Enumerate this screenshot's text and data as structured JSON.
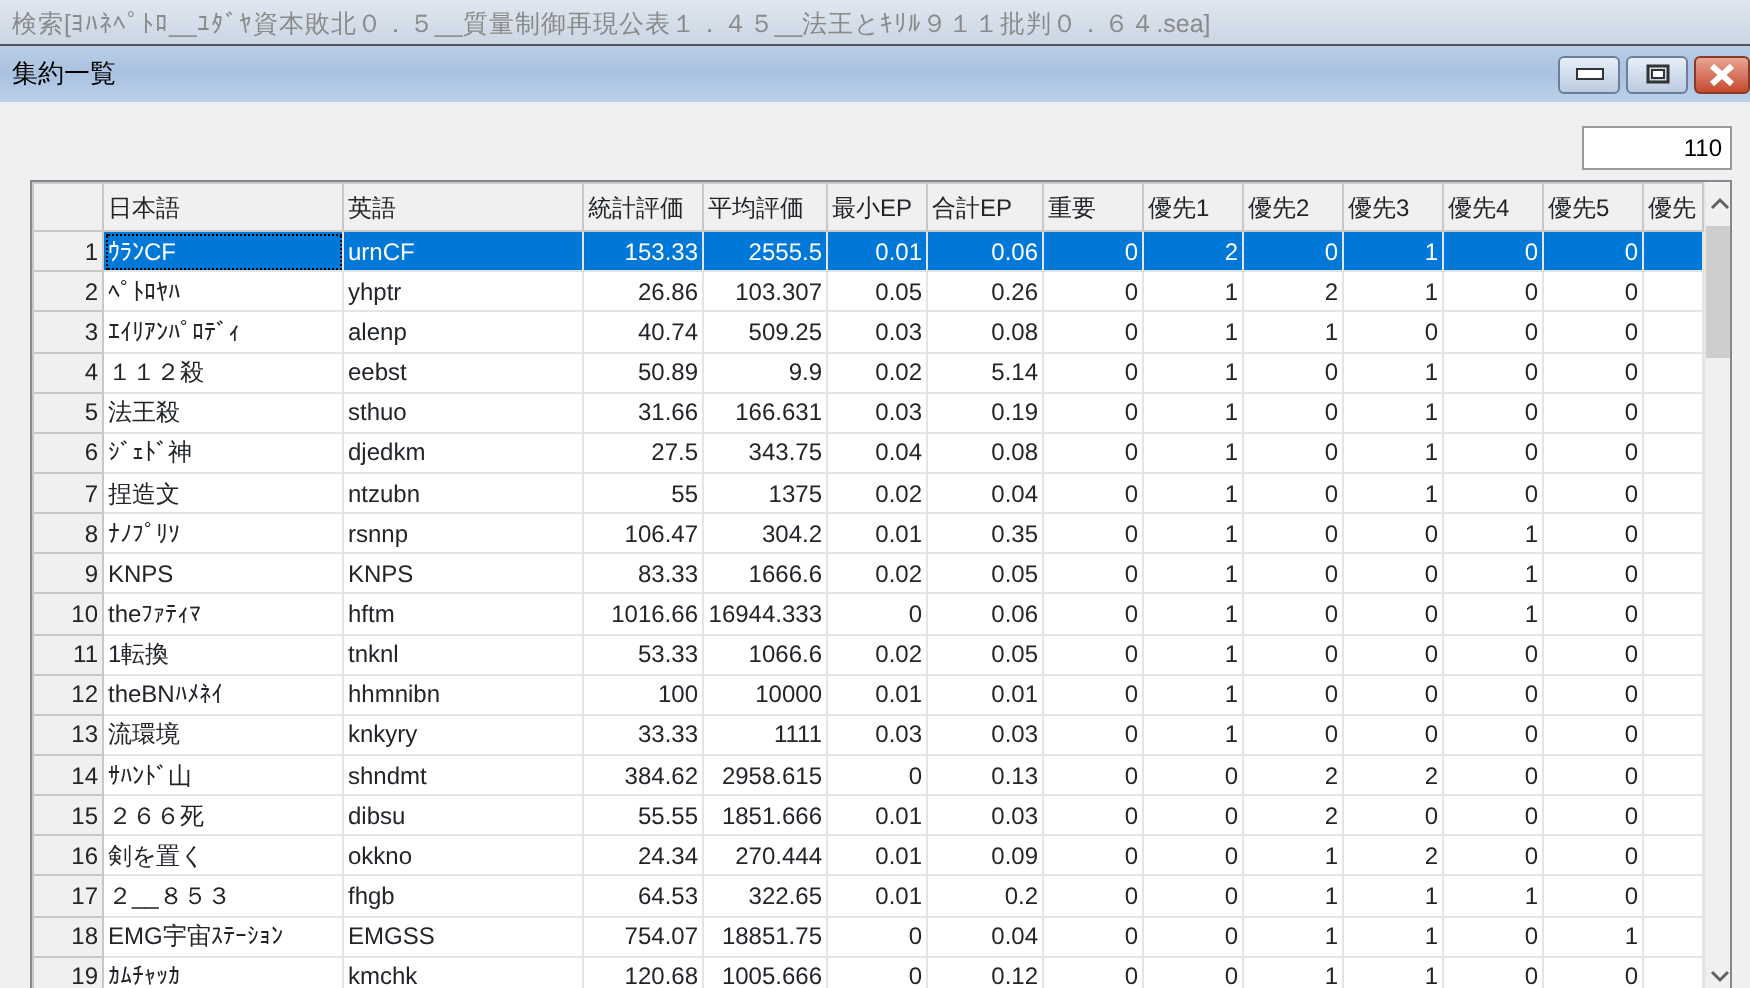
{
  "app_title": "検索[ﾖﾊﾈﾍﾟﾄﾛ__ﾕﾀﾞﾔ資本敗北０．５__質量制御再現公表１．４５__法王とｷﾘﾙ９１１批判０．６４.sea]",
  "window": {
    "title": "集約一覧"
  },
  "count_field": {
    "value": "110"
  },
  "table": {
    "columns": [
      "日本語",
      "英語",
      "統計評価",
      "平均評価",
      "最小EP",
      "合計EP",
      "重要",
      "優先1",
      "優先2",
      "優先3",
      "優先4",
      "優先5",
      "優先"
    ],
    "rows": [
      {
        "index": "1",
        "selected": true,
        "cells": [
          "ｳﾗﾝCF",
          "urnCF",
          "153.33",
          "2555.5",
          "0.01",
          "0.06",
          "0",
          "2",
          "0",
          "1",
          "0",
          "0"
        ]
      },
      {
        "index": "2",
        "selected": false,
        "cells": [
          "ﾍﾟﾄﾛﾔﾊ",
          "yhptr",
          "26.86",
          "103.307",
          "0.05",
          "0.26",
          "0",
          "1",
          "2",
          "1",
          "0",
          "0"
        ]
      },
      {
        "index": "3",
        "selected": false,
        "cells": [
          "ｴｲﾘｱﾝﾊﾟﾛﾃﾞｨ",
          "alenp",
          "40.74",
          "509.25",
          "0.03",
          "0.08",
          "0",
          "1",
          "1",
          "0",
          "0",
          "0"
        ]
      },
      {
        "index": "4",
        "selected": false,
        "cells": [
          "１１２殺",
          "eebst",
          "50.89",
          "9.9",
          "0.02",
          "5.14",
          "0",
          "1",
          "0",
          "1",
          "0",
          "0"
        ]
      },
      {
        "index": "5",
        "selected": false,
        "cells": [
          "法王殺",
          "sthuo",
          "31.66",
          "166.631",
          "0.03",
          "0.19",
          "0",
          "1",
          "0",
          "1",
          "0",
          "0"
        ]
      },
      {
        "index": "6",
        "selected": false,
        "cells": [
          "ｼﾞｪﾄﾞ神",
          "djedkm",
          "27.5",
          "343.75",
          "0.04",
          "0.08",
          "0",
          "1",
          "0",
          "1",
          "0",
          "0"
        ]
      },
      {
        "index": "7",
        "selected": false,
        "cells": [
          "捏造文",
          "ntzubn",
          "55",
          "1375",
          "0.02",
          "0.04",
          "0",
          "1",
          "0",
          "1",
          "0",
          "0"
        ]
      },
      {
        "index": "8",
        "selected": false,
        "cells": [
          "ﾅﾉﾌﾟﾘｿ",
          "rsnnp",
          "106.47",
          "304.2",
          "0.01",
          "0.35",
          "0",
          "1",
          "0",
          "0",
          "1",
          "0"
        ]
      },
      {
        "index": "9",
        "selected": false,
        "cells": [
          "KNPS",
          "KNPS",
          "83.33",
          "1666.6",
          "0.02",
          "0.05",
          "0",
          "1",
          "0",
          "0",
          "1",
          "0"
        ]
      },
      {
        "index": "10",
        "selected": false,
        "cells": [
          "theﾌｧﾃｨﾏ",
          "hftm",
          "1016.66",
          "16944.333",
          "0",
          "0.06",
          "0",
          "1",
          "0",
          "0",
          "1",
          "0"
        ]
      },
      {
        "index": "11",
        "selected": false,
        "cells": [
          "1転換",
          "tnknl",
          "53.33",
          "1066.6",
          "0.02",
          "0.05",
          "0",
          "1",
          "0",
          "0",
          "0",
          "0"
        ]
      },
      {
        "index": "12",
        "selected": false,
        "cells": [
          "theBNﾊﾒﾈｲ",
          "hhmnibn",
          "100",
          "10000",
          "0.01",
          "0.01",
          "0",
          "1",
          "0",
          "0",
          "0",
          "0"
        ]
      },
      {
        "index": "13",
        "selected": false,
        "cells": [
          "流環境",
          "knkyry",
          "33.33",
          "1111",
          "0.03",
          "0.03",
          "0",
          "1",
          "0",
          "0",
          "0",
          "0"
        ]
      },
      {
        "index": "14",
        "selected": false,
        "cells": [
          "ｻﾊﾝﾄﾞ山",
          "shndmt",
          "384.62",
          "2958.615",
          "0",
          "0.13",
          "0",
          "0",
          "2",
          "2",
          "0",
          "0"
        ]
      },
      {
        "index": "15",
        "selected": false,
        "cells": [
          "２６６死",
          "dibsu",
          "55.55",
          "1851.666",
          "0.01",
          "0.03",
          "0",
          "0",
          "2",
          "0",
          "0",
          "0"
        ]
      },
      {
        "index": "16",
        "selected": false,
        "cells": [
          "剣を置く",
          "okkno",
          "24.34",
          "270.444",
          "0.01",
          "0.09",
          "0",
          "0",
          "1",
          "2",
          "0",
          "0"
        ]
      },
      {
        "index": "17",
        "selected": false,
        "cells": [
          "２__８５３",
          "fhgb",
          "64.53",
          "322.65",
          "0.01",
          "0.2",
          "0",
          "0",
          "1",
          "1",
          "1",
          "0"
        ]
      },
      {
        "index": "18",
        "selected": false,
        "cells": [
          "EMG宇宙ｽﾃｰｼｮﾝ",
          "EMGSS",
          "754.07",
          "18851.75",
          "0",
          "0.04",
          "0",
          "0",
          "1",
          "1",
          "0",
          "1"
        ]
      },
      {
        "index": "19",
        "selected": false,
        "cells": [
          "ｶﾑﾁｬｯｶ",
          "kmchk",
          "120.68",
          "1005.666",
          "0",
          "0.12",
          "0",
          "0",
          "1",
          "1",
          "0",
          "0"
        ]
      }
    ]
  }
}
